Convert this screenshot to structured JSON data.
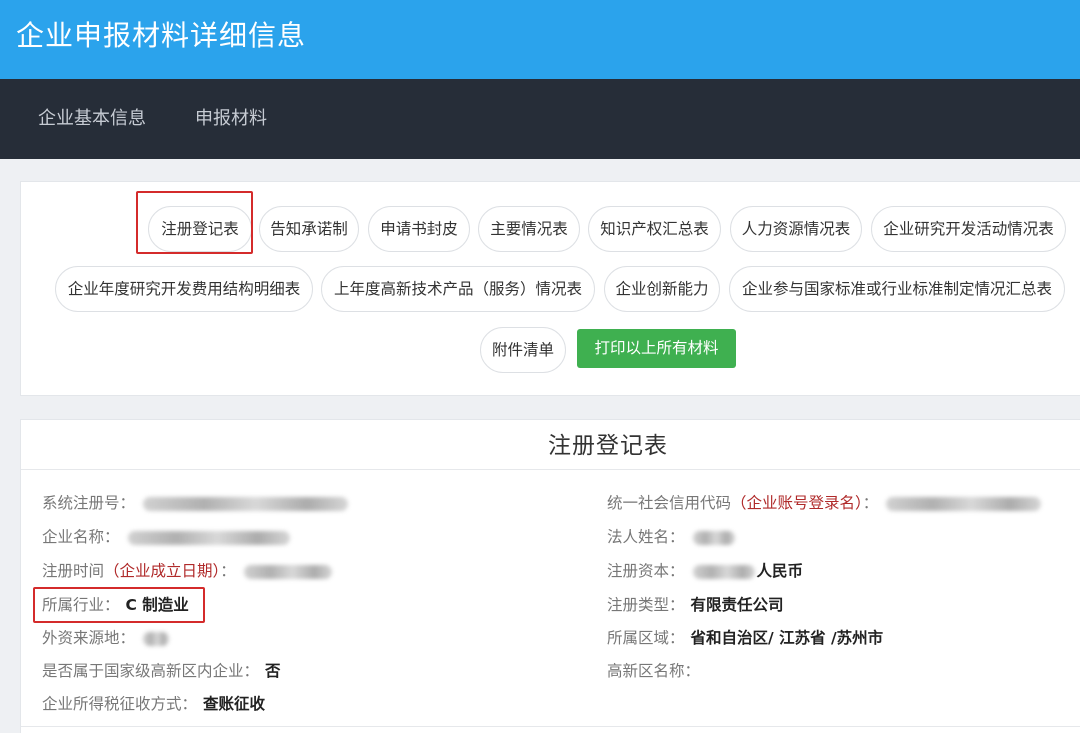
{
  "header": {
    "title": "企业申报材料详细信息"
  },
  "nav": {
    "items": [
      "企业基本信息",
      "申报材料"
    ]
  },
  "buttons": {
    "row1": [
      "注册登记表",
      "告知承诺制",
      "申请书封皮",
      "主要情况表",
      "知识产权汇总表",
      "人力资源情况表",
      "企业研究开发活动情况表"
    ],
    "row2": [
      "企业年度研究开发费用结构明细表",
      "上年度高新技术产品（服务）情况表",
      "企业创新能力",
      "企业参与国家标准或行业标准制定情况汇总表"
    ],
    "row3": [
      "附件清单"
    ],
    "print": "打印以上所有材料"
  },
  "form": {
    "title": "注册登记表",
    "left": {
      "reg_no": {
        "label": "系统注册号："
      },
      "name": {
        "label": "企业名称："
      },
      "reg_time": {
        "label": "注册时间",
        "hint": "（企业成立日期）",
        "colon": "："
      },
      "industry": {
        "label": "所属行业：",
        "value": "C 制造业"
      },
      "foreign_source": {
        "label": "外资来源地："
      },
      "national_zone": {
        "label": "是否属于国家级高新区内企业：",
        "value": "否"
      },
      "tax_method": {
        "label": "企业所得税征收方式：",
        "value": "查账征收"
      }
    },
    "right": {
      "credit_code": {
        "label": "统一社会信用代码",
        "hint": "（企业账号登录名）",
        "colon": "："
      },
      "legal_person": {
        "label": "法人姓名："
      },
      "capital": {
        "label": "注册资本：",
        "value_suffix": "人民币"
      },
      "reg_type": {
        "label": "注册类型：",
        "value": "有限责任公司"
      },
      "region": {
        "label": "所属区域：",
        "value": "省和自治区/ 江苏省 /苏州市"
      },
      "zone_name": {
        "label": "高新区名称："
      }
    }
  },
  "colors": {
    "header": "#2ba3ec",
    "nav": "#262d38",
    "print_button": "#3fb050",
    "highlight": "#d42b2b",
    "hint_text": "#b02a2a"
  },
  "icons": []
}
